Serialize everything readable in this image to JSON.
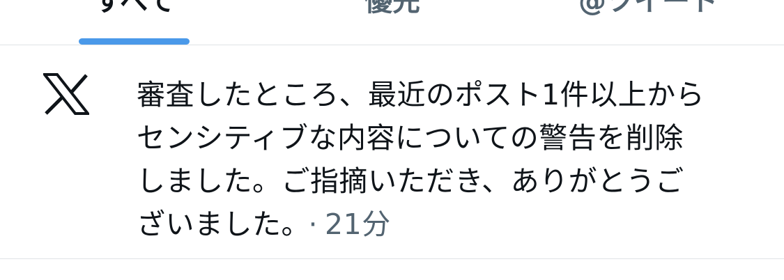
{
  "tabs": [
    {
      "label": "すべて",
      "selected": true
    },
    {
      "label": "優先",
      "selected": false
    },
    {
      "label": "@ツイート",
      "selected": false
    }
  ],
  "colors": {
    "accent": "#4a99e9",
    "text": "#0f1419",
    "secondary": "#536471",
    "divider": "#dfe3e6"
  },
  "notification": {
    "icon": "x-logo-icon",
    "lines": [
      "審査したところ、最近のポスト1件以上から",
      "センシティブな内容についての警告を削除",
      "しました。ご指摘いただき、ありがとうご",
      "ざいました。"
    ],
    "separator": "·",
    "time": "21分"
  }
}
